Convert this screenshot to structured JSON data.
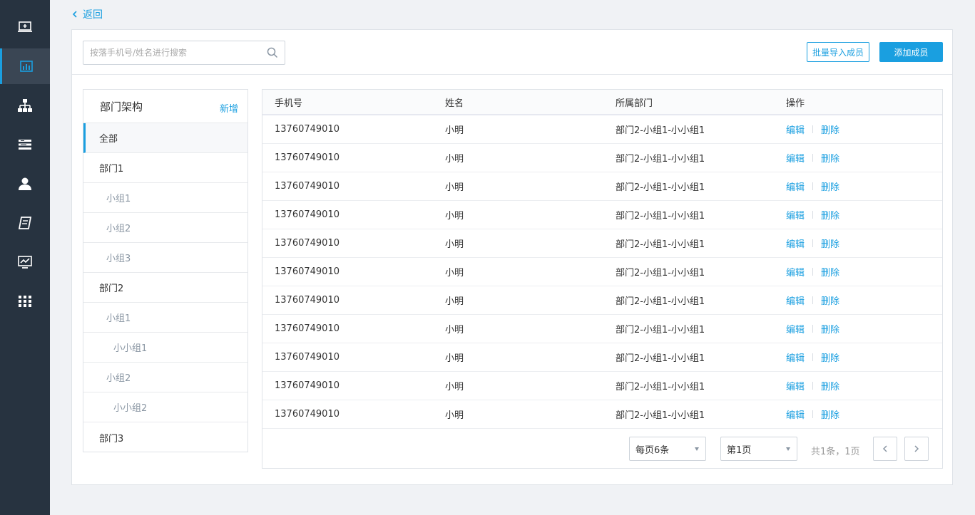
{
  "sidebar": {
    "items": [
      {
        "icon": "monitor-add-icon",
        "active": false
      },
      {
        "icon": "bar-chart-icon",
        "active": true
      },
      {
        "icon": "org-tree-icon",
        "active": false
      },
      {
        "icon": "list-icon",
        "active": false
      },
      {
        "icon": "user-icon",
        "active": false
      },
      {
        "icon": "book-icon",
        "active": false
      },
      {
        "icon": "monitor-chart-icon",
        "active": false
      },
      {
        "icon": "grid-apps-icon",
        "active": false
      }
    ],
    "accent_color": "#1a9fe0",
    "bg_color": "#273340"
  },
  "nav": {
    "back_label": "返回"
  },
  "toolbar": {
    "search_placeholder": "按落手机号/姓名进行搜索",
    "import_label": "批量导入成员",
    "add_label": "添加成员"
  },
  "departments": {
    "title": "部门架构",
    "add_label": "新增",
    "items": [
      {
        "label": "全部",
        "level": 0,
        "active": true
      },
      {
        "label": "部门1",
        "level": 0,
        "active": false
      },
      {
        "label": "小组1",
        "level": 1,
        "active": false
      },
      {
        "label": "小组2",
        "level": 1,
        "active": false
      },
      {
        "label": "小组3",
        "level": 1,
        "active": false
      },
      {
        "label": "部门2",
        "level": 0,
        "active": false
      },
      {
        "label": "小组1",
        "level": 1,
        "active": false
      },
      {
        "label": "小小组1",
        "level": 2,
        "active": false
      },
      {
        "label": "小组2",
        "level": 1,
        "active": false
      },
      {
        "label": "小小组2",
        "level": 2,
        "active": false
      },
      {
        "label": "部门3",
        "level": 0,
        "active": false
      }
    ]
  },
  "table": {
    "columns": [
      "手机号",
      "姓名",
      "所属部门",
      "操作"
    ],
    "edit_label": "编辑",
    "delete_label": "删除",
    "rows": [
      {
        "phone": "13760749010",
        "name": "小明",
        "dept": "部门2-小组1-小小组1"
      },
      {
        "phone": "13760749010",
        "name": "小明",
        "dept": "部门2-小组1-小小组1"
      },
      {
        "phone": "13760749010",
        "name": "小明",
        "dept": "部门2-小组1-小小组1"
      },
      {
        "phone": "13760749010",
        "name": "小明",
        "dept": "部门2-小组1-小小组1"
      },
      {
        "phone": "13760749010",
        "name": "小明",
        "dept": "部门2-小组1-小小组1"
      },
      {
        "phone": "13760749010",
        "name": "小明",
        "dept": "部门2-小组1-小小组1"
      },
      {
        "phone": "13760749010",
        "name": "小明",
        "dept": "部门2-小组1-小小组1"
      },
      {
        "phone": "13760749010",
        "name": "小明",
        "dept": "部门2-小组1-小小组1"
      },
      {
        "phone": "13760749010",
        "name": "小明",
        "dept": "部门2-小组1-小小组1"
      },
      {
        "phone": "13760749010",
        "name": "小明",
        "dept": "部门2-小组1-小小组1"
      },
      {
        "phone": "13760749010",
        "name": "小明",
        "dept": "部门2-小组1-小小组1"
      }
    ]
  },
  "pagination": {
    "page_size_label": "每页6条",
    "page_label": "第1页",
    "total_label": "共1条，1页"
  }
}
